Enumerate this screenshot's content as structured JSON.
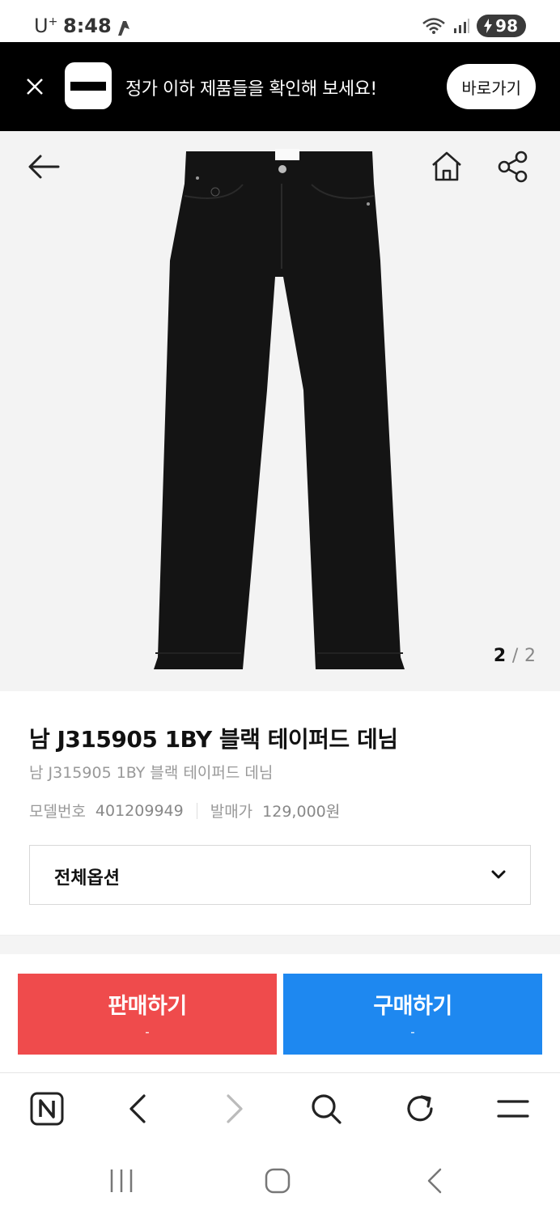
{
  "status_bar": {
    "carrier": "U",
    "carrier_sup": "+",
    "time": "8:48",
    "battery": "98"
  },
  "promo_banner": {
    "message": "정가 이하 제품들을 확인해 보세요!",
    "button_label": "바로가기"
  },
  "gallery": {
    "current": "2",
    "separator": "/",
    "total": "2"
  },
  "product": {
    "title": "남 J315905 1BY 블랙 테이퍼드 데님",
    "subtitle": "남 J315905 1BY 블랙 테이퍼드 데님",
    "model_label": "모델번호",
    "model_value": "401209949",
    "price_label": "발매가",
    "price_value": "129,000원"
  },
  "option_select": {
    "selected": "전체옵션"
  },
  "actions": {
    "sell_label": "판매하기",
    "sell_sub": "-",
    "buy_label": "구매하기",
    "buy_sub": "-"
  },
  "colors": {
    "sell": "#ef4b4c",
    "buy": "#1e88f0",
    "banner_bg": "#000000",
    "hero_bg": "#f3f3f3"
  }
}
